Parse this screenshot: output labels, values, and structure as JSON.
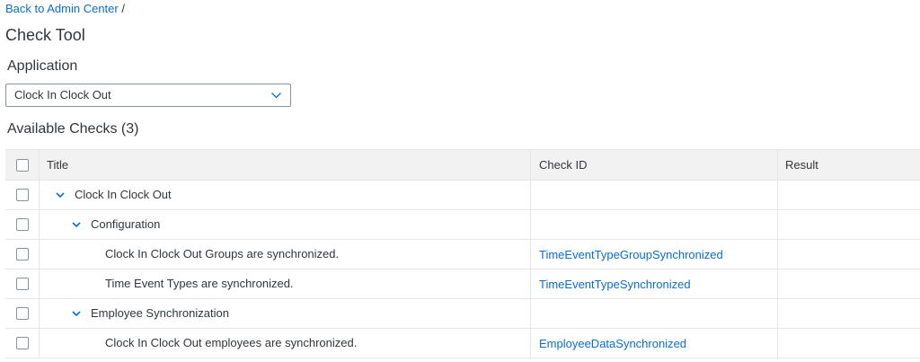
{
  "breadcrumb": {
    "link": "Back to Admin Center",
    "separator": " /"
  },
  "page_title": "Check Tool",
  "application": {
    "label": "Application",
    "selected": "Clock In Clock Out"
  },
  "available_checks": {
    "title": "Available Checks (3)"
  },
  "table": {
    "headers": {
      "title": "Title",
      "check_id": "Check ID",
      "result": "Result"
    },
    "rows": [
      {
        "title": "Clock In Clock Out",
        "check_id": "",
        "result": "",
        "level": 0,
        "expandable": true
      },
      {
        "title": "Configuration",
        "check_id": "",
        "result": "",
        "level": 1,
        "expandable": true
      },
      {
        "title": "Clock In Clock Out Groups are synchronized.",
        "check_id": "TimeEventTypeGroupSynchronized",
        "result": "",
        "level": 2,
        "expandable": false
      },
      {
        "title": "Time Event Types are synchronized.",
        "check_id": "TimeEventTypeSynchronized",
        "result": "",
        "level": 2,
        "expandable": false
      },
      {
        "title": "Employee Synchronization",
        "check_id": "",
        "result": "",
        "level": 1,
        "expandable": true
      },
      {
        "title": "Clock In Clock Out employees are synchronized.",
        "check_id": "EmployeeDataSynchronized",
        "result": "",
        "level": 2,
        "expandable": false
      }
    ]
  },
  "colors": {
    "link": "#0a6ed1",
    "text": "#32363a",
    "header_bg": "#f2f2f2",
    "border": "#e5e5e5"
  },
  "icons": {
    "select_chevron": "chevron-down-icon",
    "expander": "chevron-down-icon"
  }
}
